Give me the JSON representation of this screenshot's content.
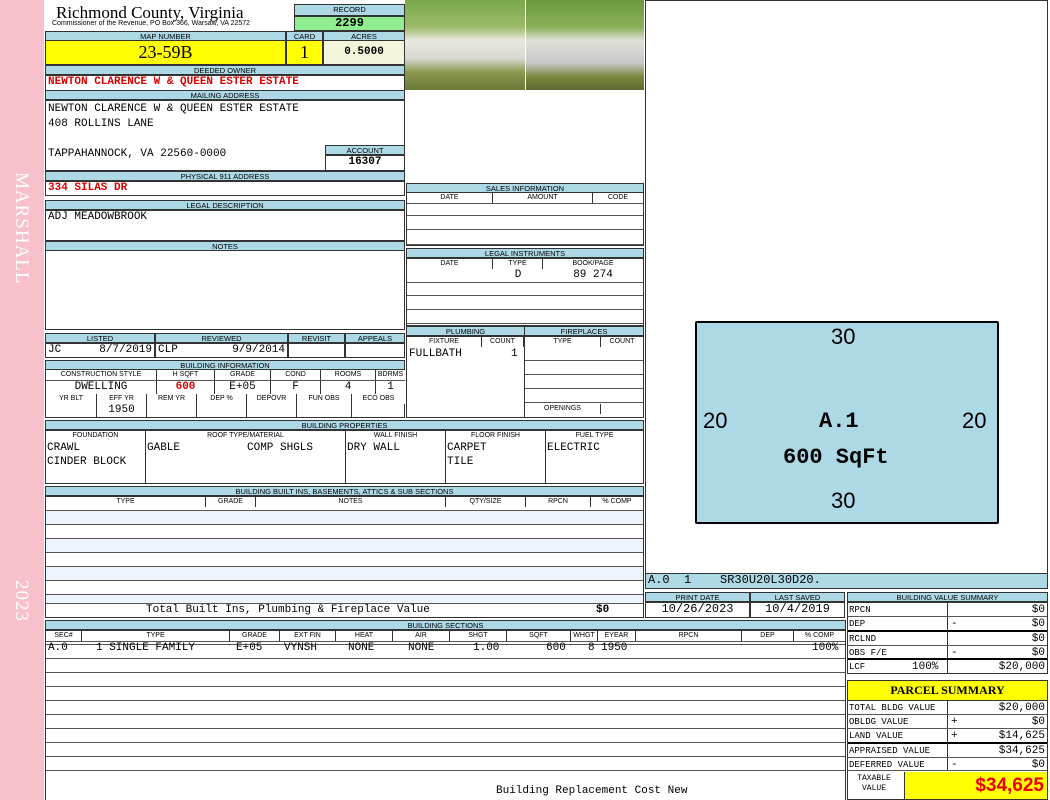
{
  "side": {
    "district": "MARSHALL",
    "year": "2023"
  },
  "header": {
    "county": "Richmond County, Virginia",
    "address": "Commissioner of the Revenue, PO Box 366, Warsaw, VA 22572",
    "record_label": "RECORD",
    "record": "2299"
  },
  "parcel": {
    "map_label": "MAP NUMBER",
    "map": "23-59B",
    "card_label": "CARD",
    "card": "1",
    "acres_label": "ACRES",
    "acres": "0.5000"
  },
  "owner": {
    "label": "DEEDED OWNER",
    "name": "NEWTON CLARENCE W & QUEEN ESTER ESTATE"
  },
  "mailing": {
    "label": "MAILING ADDRESS",
    "line1": "NEWTON CLARENCE W & QUEEN ESTER ESTATE",
    "line2": "408 ROLLINS LANE",
    "line3": "TAPPAHANNOCK, VA 22560-0000",
    "account_label": "ACCOUNT",
    "account": "16307"
  },
  "physical": {
    "label": "PHYSICAL 911 ADDRESS",
    "value": "334 SILAS DR"
  },
  "legal": {
    "label": "LEGAL DESCRIPTION",
    "value": "ADJ MEADOWBROOK"
  },
  "notes": {
    "label": "NOTES"
  },
  "review": {
    "listed_label": "LISTED",
    "reviewed_label": "REVIEWED",
    "revisit_label": "REVISIT",
    "appeals_label": "APPEALS",
    "listed_by": "JC",
    "listed_date": "8/7/2019",
    "reviewed_by": "CLP",
    "reviewed_date": "9/9/2014"
  },
  "building_info": {
    "label": "BUILDING INFORMATION",
    "h1": [
      "CONSTRUCTION STYLE",
      "H SQFT",
      "GRADE",
      "COND",
      "ROOMS",
      "BDRMS"
    ],
    "v1": [
      "DWELLING",
      "600",
      "E+05",
      "F",
      "4",
      "1"
    ],
    "h2": [
      "YR BLT",
      "EFF YR",
      "REM YR",
      "DEP %",
      "DEPOVR",
      "FUN OBS",
      "ECO OBS"
    ],
    "v2": [
      "",
      "1950",
      "",
      "",
      "",
      "",
      ""
    ]
  },
  "sales": {
    "label": "SALES INFORMATION",
    "cols": [
      "DATE",
      "AMOUNT",
      "CODE"
    ]
  },
  "instruments": {
    "label": "LEGAL INSTRUMENTS",
    "cols": [
      "DATE",
      "TYPE",
      "BOOK/PAGE"
    ],
    "rows": [
      {
        "date": "",
        "type": "D",
        "book": "89 274"
      }
    ]
  },
  "plumbing": {
    "label": "PLUMBING",
    "cols": [
      "FIXTURE",
      "COUNT"
    ],
    "rows": [
      {
        "fixture": "FULLBATH",
        "count": "1"
      }
    ]
  },
  "fireplaces": {
    "label": "FIREPLACES",
    "cols": [
      "TYPE",
      "COUNT"
    ],
    "openings": "OPENINGS"
  },
  "properties": {
    "label": "BUILDING PROPERTIES",
    "cols": [
      "FOUNDATION",
      "ROOF TYPE/MATERIAL",
      "WALL FINISH",
      "FLOOR FINISH",
      "FUEL TYPE"
    ],
    "foundation": [
      "CRAWL",
      "CINDER BLOCK"
    ],
    "roof_type": "GABLE",
    "roof_material": "COMP SHGLS",
    "wall": "DRY WALL",
    "floor": [
      "CARPET",
      "TILE"
    ],
    "fuel": "ELECTRIC"
  },
  "builtins": {
    "label": "BUILDING BUILT INS, BASEMENTS, ATTICS & SUB SECTIONS",
    "cols": [
      "TYPE",
      "GRADE",
      "NOTES",
      "QTY/SIZE",
      "RPCN",
      "% COMP"
    ],
    "total_label": "Total Built Ins, Plumbing & Fireplace Value",
    "total": "$0"
  },
  "sections": {
    "label": "BUILDING SECTIONS",
    "cols": [
      "SEC#",
      "TYPE",
      "GRADE",
      "EXT FIN",
      "HEAT",
      "AIR",
      "SHGT",
      "SQFT",
      "WHGT",
      "EYEAR",
      "RPCN",
      "DEP",
      "% COMP"
    ],
    "row": [
      "A.0",
      "1 SINGLE FAMILY",
      "E+05",
      "VYNSH",
      "NONE",
      "NONE",
      "1.00",
      "600",
      "8",
      "1950",
      "",
      "",
      "100%"
    ],
    "footer": "Building Replacement Cost New"
  },
  "sketch": {
    "top": "30",
    "bottom": "30",
    "left": "20",
    "right": "20",
    "label": "A.1",
    "area": "600 SqFt",
    "code": "A.0  1    SR30U20L30D20.",
    "fill": "#add8e6"
  },
  "dates": {
    "print_label": "PRINT DATE",
    "print": "10/26/2023",
    "saved_label": "LAST SAVED",
    "saved": "10/4/2019"
  },
  "value_summary": {
    "label": "BUILDING VALUE SUMMARY",
    "rows": [
      {
        "k": "RPCN",
        "op": "",
        "v": "$0"
      },
      {
        "k": "DEP",
        "op": "-",
        "v": "$0"
      },
      {
        "k": "RCLND",
        "op": "",
        "v": "$0"
      },
      {
        "k": "OBS F/E",
        "op": "-",
        "v": "$0"
      },
      {
        "k": "LCF",
        "pct": "100%",
        "op": "",
        "v": "$20,000"
      }
    ]
  },
  "parcel_summary": {
    "label": "PARCEL SUMMARY",
    "rows": [
      {
        "k": "TOTAL BLDG VALUE",
        "op": "",
        "v": "$20,000"
      },
      {
        "k": "OBLDG VALUE",
        "op": "+",
        "v": "$0"
      },
      {
        "k": "LAND VALUE",
        "op": "+",
        "v": "$14,625"
      },
      {
        "k": "APPRAISED VALUE",
        "op": "",
        "v": "$34,625"
      },
      {
        "k": "DEFERRED VALUE",
        "op": "-",
        "v": "$0"
      }
    ],
    "taxable_label1": "TAXABLE",
    "taxable_label2": "VALUE",
    "taxable": "$34,625"
  }
}
